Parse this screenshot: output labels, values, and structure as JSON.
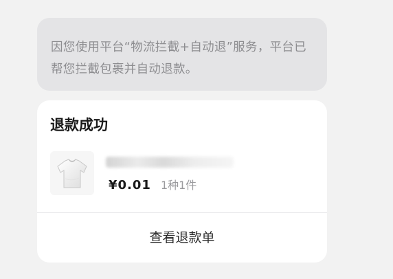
{
  "notice": {
    "text": "因您使用平台“物流拦截+自动退”服务，平台已帮您拦截包裹并自动退款。"
  },
  "refund_card": {
    "title": "退款成功",
    "product": {
      "thumbnail_icon": "tshirt-icon",
      "price": "¥0.01",
      "quantity": "1种1件"
    },
    "action_label": "查看退款单"
  }
}
